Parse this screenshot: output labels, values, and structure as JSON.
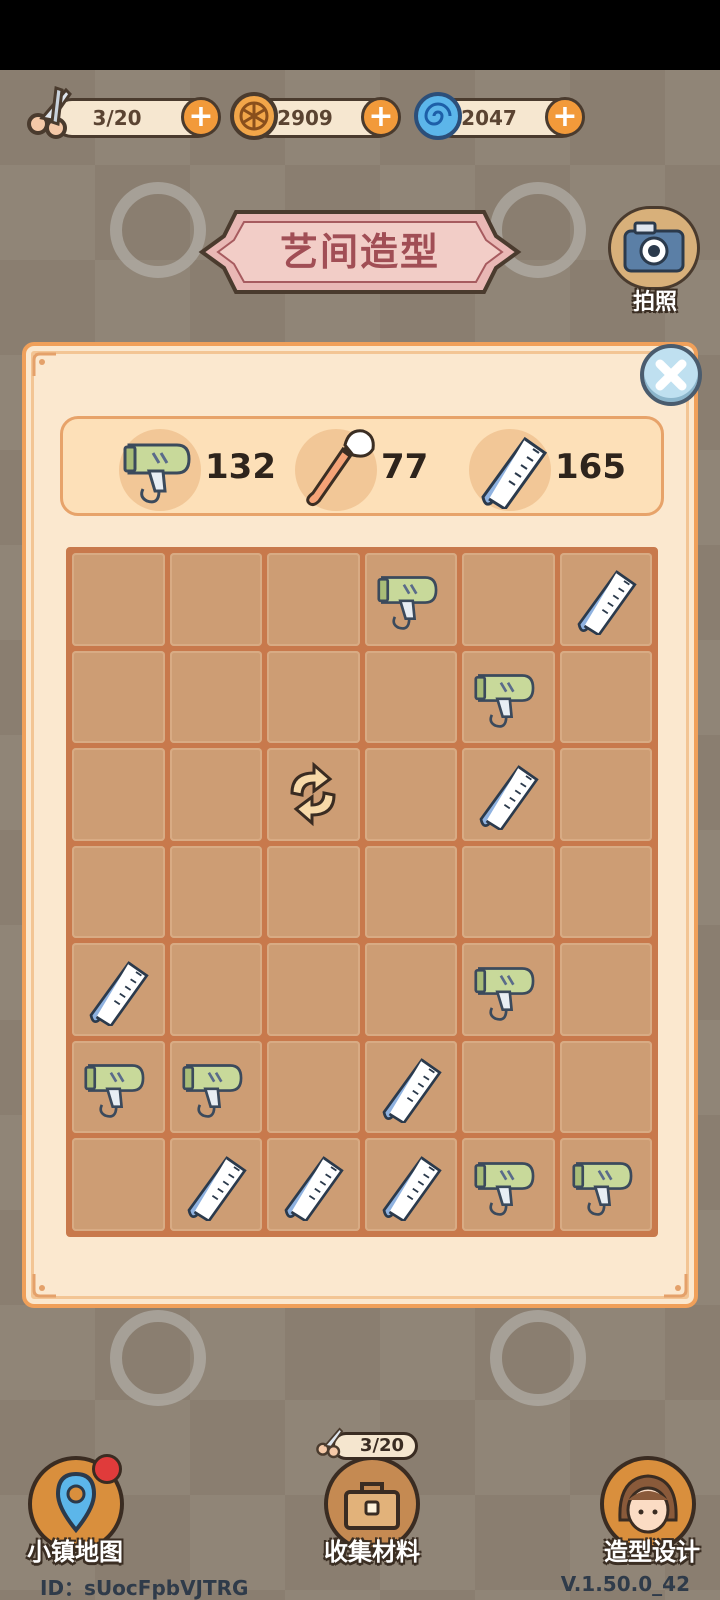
{
  "resources": {
    "scissors": {
      "value": "3/20",
      "icon": "scissors-icon"
    },
    "coins": {
      "value": "2909",
      "icon": "coin-icon"
    },
    "gems": {
      "value": "2047",
      "icon": "swirl-gem-icon"
    },
    "plus_label": "+"
  },
  "title": "艺间造型",
  "camera": {
    "label": "拍照",
    "icon": "camera-icon"
  },
  "counters": [
    {
      "item": "hair-dryer",
      "value": "132"
    },
    {
      "item": "makeup-brush",
      "value": "77"
    },
    {
      "item": "comb",
      "value": "165"
    }
  ],
  "board": {
    "columns": 6,
    "rows": [
      [
        "",
        "",
        "",
        "dryer",
        "",
        "comb"
      ],
      [
        "",
        "",
        "",
        "",
        "dryer",
        ""
      ],
      [
        "",
        "",
        "refresh",
        "",
        "comb",
        ""
      ],
      [
        "",
        "",
        "",
        "",
        "",
        ""
      ],
      [
        "comb",
        "",
        "",
        "",
        "dryer",
        ""
      ],
      [
        "dryer",
        "dryer",
        "",
        "comb",
        "",
        ""
      ],
      [
        "",
        "comb",
        "comb",
        "comb",
        "dryer",
        "dryer"
      ]
    ]
  },
  "nav": {
    "map_label": "小镇地图",
    "collect_label": "收集材料",
    "collect_energy": "3/20",
    "design_label": "造型设计"
  },
  "footer": {
    "id": "ID：sUocFpbVJTRG",
    "version": "V.1.50.0_42"
  },
  "colors": {
    "panel_bg": "#fbe8cf",
    "cell": "#cd9d74",
    "grid_lines": "#c8794c",
    "accent_orange": "#f29a3a",
    "title": "#a14e55"
  }
}
